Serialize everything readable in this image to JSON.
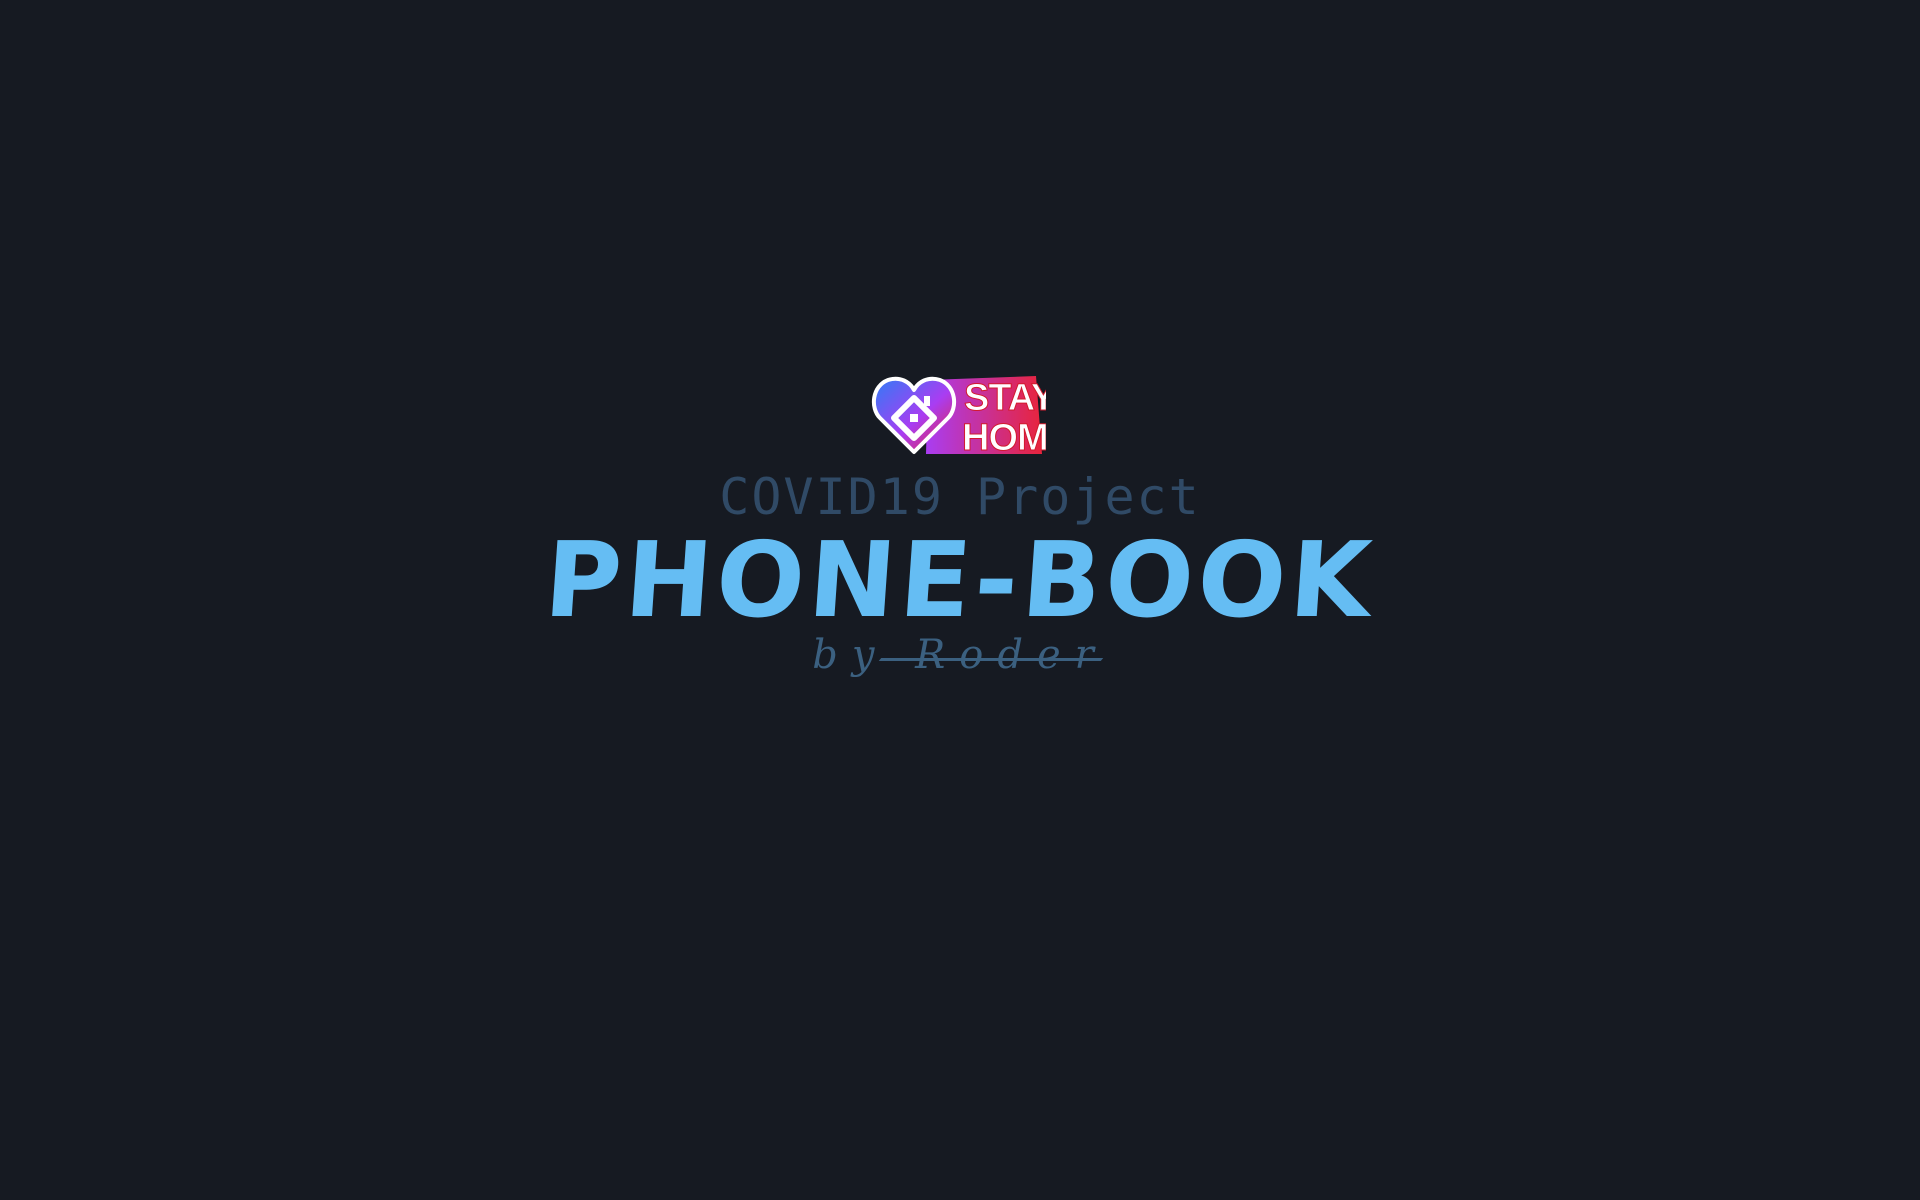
{
  "splash": {
    "logo": {
      "line1": "STAY",
      "line2": "HOME",
      "icon": "heart-house-icon"
    },
    "subtitle": "COVID19  Project",
    "title": "PHONE-BOOK",
    "byline": "by Roder"
  },
  "colors": {
    "background": "#161a22",
    "title": "#65bdf3",
    "subtitle": "#304a66",
    "byline": "#3b6080",
    "logo_gradient_start": "#2f7cf6",
    "logo_gradient_mid": "#a93df2",
    "logo_gradient_end": "#e8243c"
  }
}
